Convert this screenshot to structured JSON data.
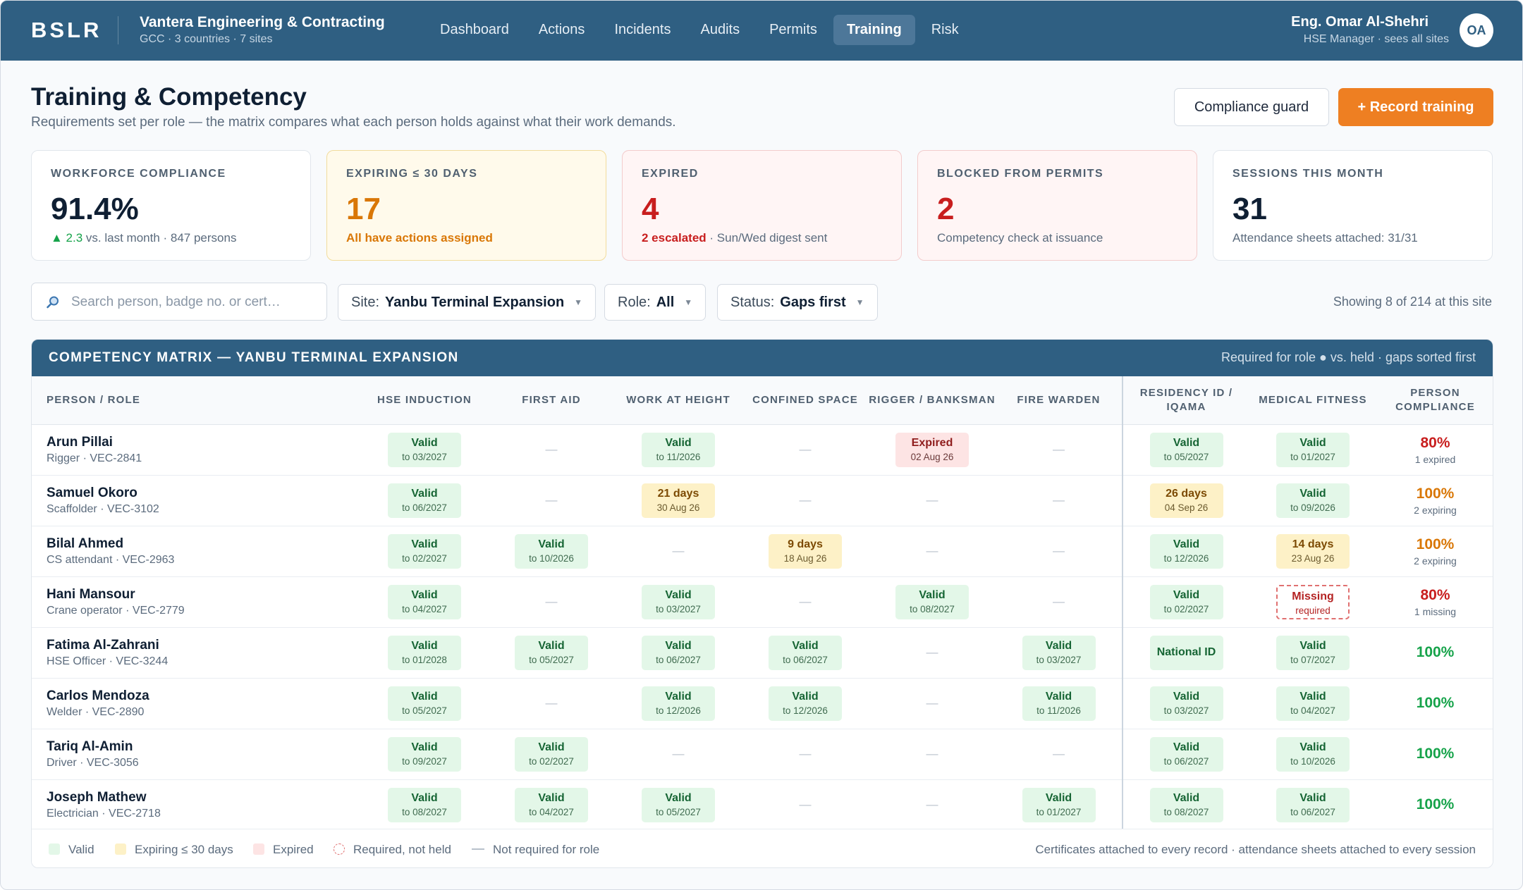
{
  "app": {
    "logo": "BSLR",
    "org_name": "Vantera Engineering & Contracting",
    "org_sub": "GCC · 3 countries · 7 sites",
    "nav": [
      "Dashboard",
      "Actions",
      "Incidents",
      "Audits",
      "Permits",
      "Training",
      "Risk"
    ],
    "active_nav": "Training",
    "user_name": "Eng. Omar Al-Shehri",
    "user_role": "HSE Manager · sees all sites",
    "user_initials": "OA"
  },
  "header": {
    "title": "Training & Competency",
    "subtitle": "Requirements set per role — the matrix compares what each person holds against what their work demands.",
    "guard_button": "Compliance guard",
    "record_button": "+ Record training"
  },
  "kpis": {
    "compliance": {
      "label": "WORKFORCE COMPLIANCE",
      "value": "91.4%",
      "delta": "▲ 2.3",
      "note": " vs. last month · 847 persons"
    },
    "expiring": {
      "label": "EXPIRING ≤ 30 DAYS",
      "value": "17",
      "note": "All have actions assigned"
    },
    "expired": {
      "label": "EXPIRED",
      "value": "4",
      "highlight": "2 escalated",
      "note": " · Sun/Wed digest sent"
    },
    "blocked": {
      "label": "BLOCKED FROM PERMITS",
      "value": "2",
      "note": "Competency check at issuance"
    },
    "sessions": {
      "label": "SESSIONS THIS MONTH",
      "value": "31",
      "note": "Attendance sheets attached: 31/31"
    }
  },
  "filters": {
    "search_placeholder": "Search person, badge no. or cert…",
    "site_label": "Site:",
    "site_value": "Yanbu Terminal Expansion",
    "role_label": "Role:",
    "role_value": "All",
    "status_label": "Status:",
    "status_value": "Gaps first",
    "showing": "Showing 8 of 214 at this site"
  },
  "matrix": {
    "title": "COMPETENCY MATRIX — YANBU TERMINAL EXPANSION",
    "meta": "Required for role ● vs. held · gaps sorted first",
    "columns": [
      "PERSON / ROLE",
      "HSE INDUCTION",
      "FIRST AID",
      "WORK AT HEIGHT",
      "CONFINED SPACE",
      "RIGGER / BANKSMAN",
      "FIRE WARDEN",
      "RESIDENCY ID / IQAMA",
      "MEDICAL FITNESS",
      "PERSON COMPLIANCE"
    ],
    "rows": [
      {
        "name": "Arun Pillai",
        "role": "Rigger · VEC-2841",
        "cells": [
          {
            "s": "valid",
            "t": "Valid",
            "d": "to 03/2027"
          },
          {
            "s": "na"
          },
          {
            "s": "valid",
            "t": "Valid",
            "d": "to 11/2026"
          },
          {
            "s": "na"
          },
          {
            "s": "expired",
            "t": "Expired",
            "d": "02 Aug 26"
          },
          {
            "s": "na"
          },
          {
            "s": "valid",
            "t": "Valid",
            "d": "to 05/2027"
          },
          {
            "s": "valid",
            "t": "Valid",
            "d": "to 01/2027"
          }
        ],
        "pct": "80%",
        "pct_note": "1 expired",
        "tone": "red"
      },
      {
        "name": "Samuel Okoro",
        "role": "Scaffolder · VEC-3102",
        "cells": [
          {
            "s": "valid",
            "t": "Valid",
            "d": "to 06/2027"
          },
          {
            "s": "na"
          },
          {
            "s": "expiring",
            "t": "21 days",
            "d": "30 Aug 26"
          },
          {
            "s": "na"
          },
          {
            "s": "na"
          },
          {
            "s": "na"
          },
          {
            "s": "expiring",
            "t": "26 days",
            "d": "04 Sep 26"
          },
          {
            "s": "valid",
            "t": "Valid",
            "d": "to 09/2026"
          }
        ],
        "pct": "100%",
        "pct_note": "2 expiring",
        "tone": "amber"
      },
      {
        "name": "Bilal Ahmed",
        "role": "CS attendant · VEC-2963",
        "cells": [
          {
            "s": "valid",
            "t": "Valid",
            "d": "to 02/2027"
          },
          {
            "s": "valid",
            "t": "Valid",
            "d": "to 10/2026"
          },
          {
            "s": "na"
          },
          {
            "s": "expiring",
            "t": "9 days",
            "d": "18 Aug 26"
          },
          {
            "s": "na"
          },
          {
            "s": "na"
          },
          {
            "s": "valid",
            "t": "Valid",
            "d": "to 12/2026"
          },
          {
            "s": "expiring",
            "t": "14 days",
            "d": "23 Aug 26"
          }
        ],
        "pct": "100%",
        "pct_note": "2 expiring",
        "tone": "amber"
      },
      {
        "name": "Hani Mansour",
        "role": "Crane operator · VEC-2779",
        "cells": [
          {
            "s": "valid",
            "t": "Valid",
            "d": "to 04/2027"
          },
          {
            "s": "na"
          },
          {
            "s": "valid",
            "t": "Valid",
            "d": "to 03/2027"
          },
          {
            "s": "na"
          },
          {
            "s": "valid",
            "t": "Valid",
            "d": "to 08/2027"
          },
          {
            "s": "na"
          },
          {
            "s": "valid",
            "t": "Valid",
            "d": "to 02/2027"
          },
          {
            "s": "missing",
            "t": "Missing",
            "d": "required"
          }
        ],
        "pct": "80%",
        "pct_note": "1 missing",
        "tone": "red"
      },
      {
        "name": "Fatima Al-Zahrani",
        "role": "HSE Officer · VEC-3244",
        "cells": [
          {
            "s": "valid",
            "t": "Valid",
            "d": "to 01/2028"
          },
          {
            "s": "valid",
            "t": "Valid",
            "d": "to 05/2027"
          },
          {
            "s": "valid",
            "t": "Valid",
            "d": "to 06/2027"
          },
          {
            "s": "valid",
            "t": "Valid",
            "d": "to 06/2027"
          },
          {
            "s": "na"
          },
          {
            "s": "valid",
            "t": "Valid",
            "d": "to 03/2027"
          },
          {
            "s": "natid",
            "t": "National ID"
          },
          {
            "s": "valid",
            "t": "Valid",
            "d": "to 07/2027"
          }
        ],
        "pct": "100%",
        "pct_note": "",
        "tone": "green"
      },
      {
        "name": "Carlos Mendoza",
        "role": "Welder · VEC-2890",
        "cells": [
          {
            "s": "valid",
            "t": "Valid",
            "d": "to 05/2027"
          },
          {
            "s": "na"
          },
          {
            "s": "valid",
            "t": "Valid",
            "d": "to 12/2026"
          },
          {
            "s": "valid",
            "t": "Valid",
            "d": "to 12/2026"
          },
          {
            "s": "na"
          },
          {
            "s": "valid",
            "t": "Valid",
            "d": "to 11/2026"
          },
          {
            "s": "valid",
            "t": "Valid",
            "d": "to 03/2027"
          },
          {
            "s": "valid",
            "t": "Valid",
            "d": "to 04/2027"
          }
        ],
        "pct": "100%",
        "pct_note": "",
        "tone": "green"
      },
      {
        "name": "Tariq Al-Amin",
        "role": "Driver · VEC-3056",
        "cells": [
          {
            "s": "valid",
            "t": "Valid",
            "d": "to 09/2027"
          },
          {
            "s": "valid",
            "t": "Valid",
            "d": "to 02/2027"
          },
          {
            "s": "na"
          },
          {
            "s": "na"
          },
          {
            "s": "na"
          },
          {
            "s": "na"
          },
          {
            "s": "valid",
            "t": "Valid",
            "d": "to 06/2027"
          },
          {
            "s": "valid",
            "t": "Valid",
            "d": "to 10/2026"
          }
        ],
        "pct": "100%",
        "pct_note": "",
        "tone": "green"
      },
      {
        "name": "Joseph Mathew",
        "role": "Electrician · VEC-2718",
        "cells": [
          {
            "s": "valid",
            "t": "Valid",
            "d": "to 08/2027"
          },
          {
            "s": "valid",
            "t": "Valid",
            "d": "to 04/2027"
          },
          {
            "s": "valid",
            "t": "Valid",
            "d": "to 05/2027"
          },
          {
            "s": "na"
          },
          {
            "s": "na"
          },
          {
            "s": "valid",
            "t": "Valid",
            "d": "to 01/2027"
          },
          {
            "s": "valid",
            "t": "Valid",
            "d": "to 08/2027"
          },
          {
            "s": "valid",
            "t": "Valid",
            "d": "to 06/2027"
          }
        ],
        "pct": "100%",
        "pct_note": "",
        "tone": "green"
      }
    ],
    "na_symbol": "—",
    "legend": {
      "valid": "Valid",
      "expiring": "Expiring ≤ 30 days",
      "expired": "Expired",
      "missing": "Required, not held",
      "na": "Not required for role"
    },
    "footer_note": "Certificates attached to every record · attendance sheets attached to every session"
  },
  "colors": {
    "brand": "#2f5f82",
    "accent": "#ee7f22",
    "valid": "#e3f7e8",
    "expiring": "#fdf1c7",
    "expired": "#fde4e4"
  }
}
